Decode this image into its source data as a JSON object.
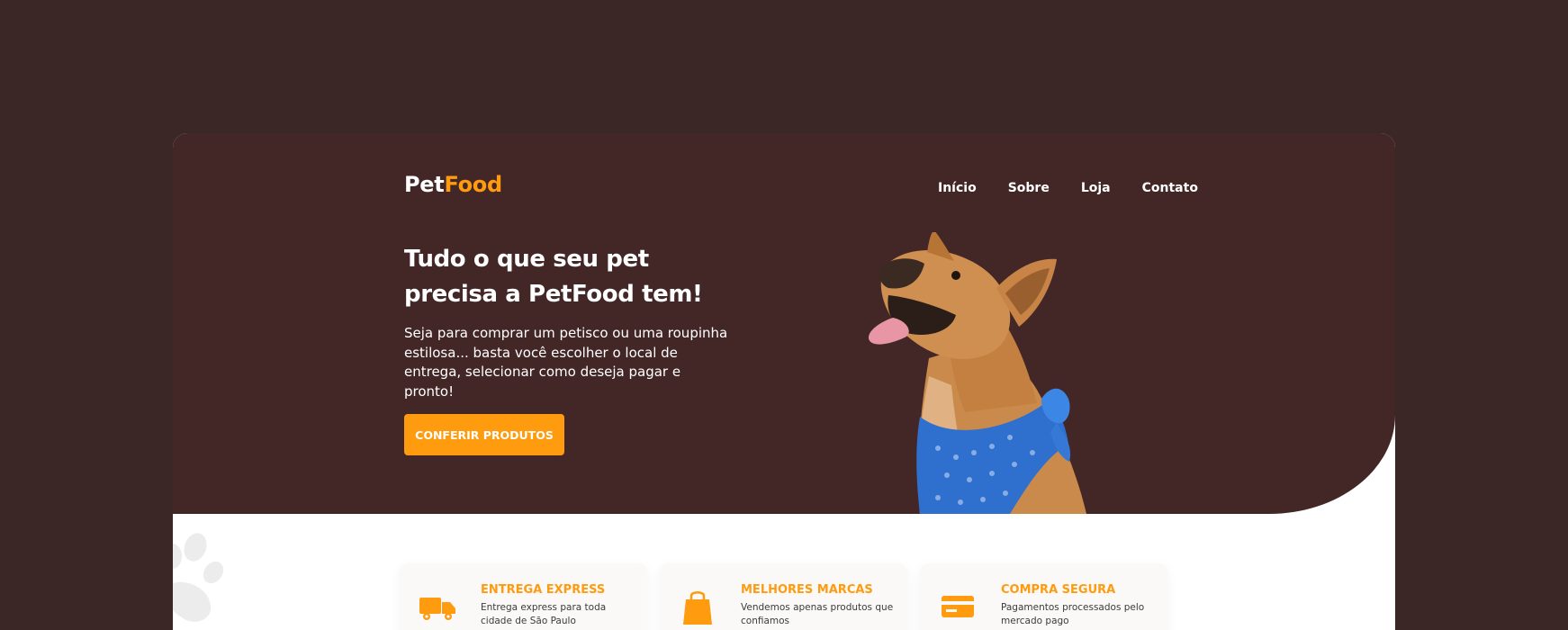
{
  "logo": {
    "first": "Pet",
    "second": "Food"
  },
  "nav": {
    "items": [
      {
        "label": "Início"
      },
      {
        "label": "Sobre"
      },
      {
        "label": "Loja"
      },
      {
        "label": "Contato"
      }
    ]
  },
  "hero": {
    "headline": "Tudo o que seu pet precisa a PetFood tem!",
    "subtext": "Seja para comprar um petisco ou uma roupinha estilosa... basta você escolher o local de entrega, selecionar como deseja pagar e pronto!",
    "cta_label": "CONFERIR PRODUTOS"
  },
  "features": [
    {
      "title": "ENTREGA EXPRESS",
      "description": "Entrega express para toda cidade de São Paulo",
      "icon": "truck-icon"
    },
    {
      "title": "MELHORES MARCAS",
      "description": "Vendemos apenas produtos que confiamos",
      "icon": "shopping-bag-icon"
    },
    {
      "title": "COMPRA SEGURA",
      "description": "Pagamentos processados pelo mercado pago",
      "icon": "credit-card-icon"
    }
  ],
  "colors": {
    "background": "#3b2726",
    "hero": "#432727",
    "accent": "#ff9b0f",
    "card": "#ffffff"
  }
}
